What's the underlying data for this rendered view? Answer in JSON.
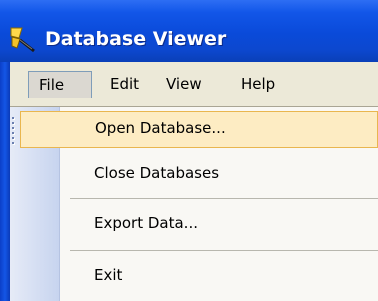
{
  "window": {
    "title": "Database Viewer",
    "icon": "database-viewer-app-icon"
  },
  "menubar": {
    "items": [
      {
        "label": "File"
      },
      {
        "label": "Edit"
      },
      {
        "label": "View"
      },
      {
        "label": "Help"
      }
    ],
    "open_menu": "File"
  },
  "file_menu": {
    "items": [
      {
        "label": "Open Database..."
      },
      {
        "label": "Close Databases"
      },
      {
        "label": "Export Data..."
      },
      {
        "label": "Exit"
      }
    ],
    "highlighted": "Open Database..."
  },
  "colors": {
    "titlebar": "#0a4ad9",
    "menubar": "#ece9d8",
    "highlight_fill": "#fdecc3",
    "highlight_border": "#e9b64f",
    "gutter": "#c7d4ef"
  }
}
